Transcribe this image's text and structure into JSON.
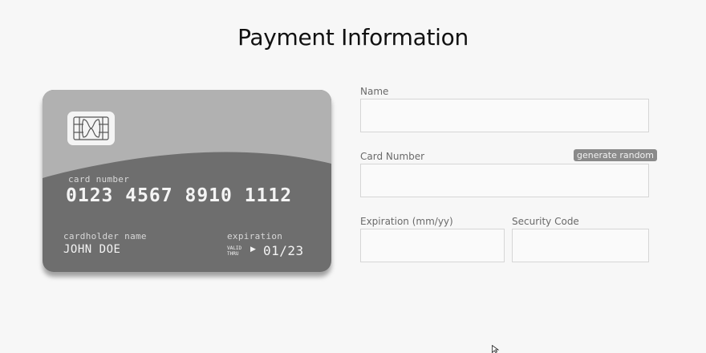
{
  "page": {
    "title": "Payment Information"
  },
  "card": {
    "number_label": "card number",
    "number": "0123 4567 8910 1112",
    "holder_label": "cardholder name",
    "holder": "JOHN DOE",
    "expiration_label": "expiration",
    "valid_thru": "VALID THRU",
    "arrow": "▶",
    "expiration": "01/23"
  },
  "form": {
    "name_label": "Name",
    "name_value": "",
    "card_number_label": "Card Number",
    "card_number_value": "",
    "generate_label": "generate random",
    "expiration_label": "Expiration (mm/yy)",
    "expiration_value": "",
    "security_label": "Security Code",
    "security_value": ""
  },
  "colors": {
    "card_body": "#6e6e6e",
    "card_top": "#b1b1b1",
    "generate_button": "#8a8a8a"
  },
  "icons": [
    "chip-icon",
    "mouse-cursor-icon"
  ]
}
